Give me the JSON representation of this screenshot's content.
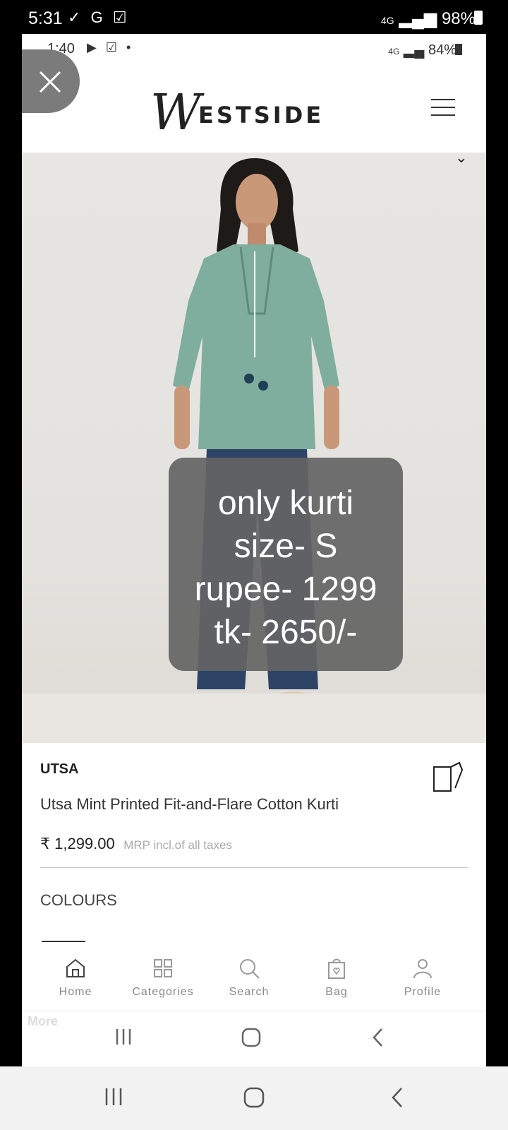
{
  "outer_status": {
    "time": "5:31",
    "icons": "G",
    "network": "4G",
    "battery": "98%"
  },
  "inner_status": {
    "time": "1:40",
    "network": "4G",
    "battery": "84%"
  },
  "header": {
    "logo_initial": "W",
    "logo_rest": "ESTSIDE"
  },
  "overlay": {
    "lines": [
      "only kurti",
      "size- S",
      "rupee- 1299",
      "tk- 2650/-"
    ]
  },
  "product": {
    "brand": "UTSA",
    "name": "Utsa Mint Printed Fit-and-Flare Cotton Kurti",
    "price": "₹ 1,299.00",
    "mrp_note": "MRP incl.of all taxes",
    "colours_label": "COLOURS"
  },
  "bottom_nav": [
    {
      "label": "Home",
      "icon": "home-icon"
    },
    {
      "label": "Categories",
      "icon": "grid-icon"
    },
    {
      "label": "Search",
      "icon": "search-icon"
    },
    {
      "label": "Bag",
      "icon": "bag-icon"
    },
    {
      "label": "Profile",
      "icon": "profile-icon"
    }
  ],
  "inner_sys": {
    "more_label": "More"
  },
  "colors": {
    "mint_kurti": "#7fae9e",
    "denim": "#2e4466",
    "overlay_bg": "#646464"
  }
}
